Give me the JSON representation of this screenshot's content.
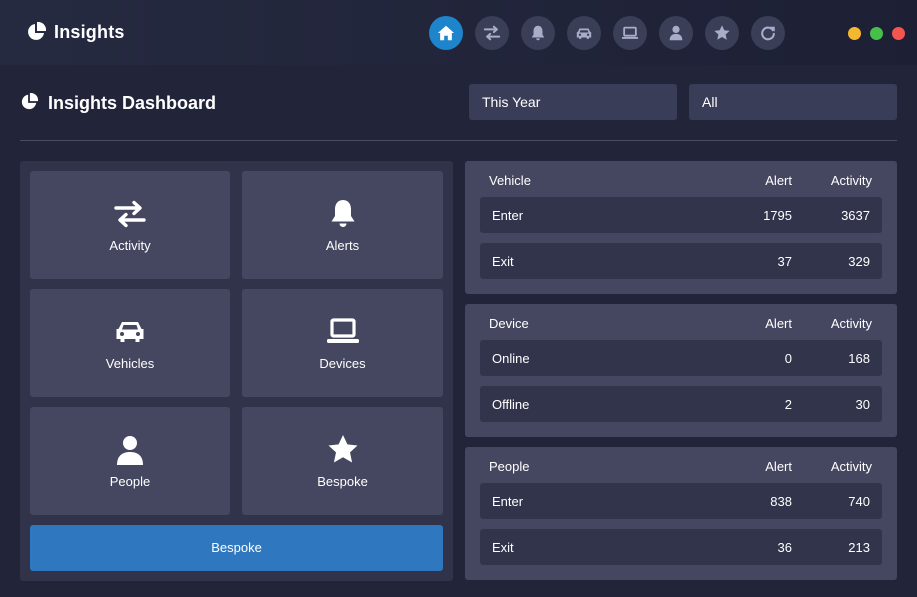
{
  "app": {
    "title": "Insights"
  },
  "nav": [
    {
      "name": "home",
      "icon": "home-icon",
      "active": true
    },
    {
      "name": "activity",
      "icon": "swap-arrows-icon",
      "active": false
    },
    {
      "name": "alerts",
      "icon": "bell-icon",
      "active": false
    },
    {
      "name": "vehicles",
      "icon": "car-icon",
      "active": false
    },
    {
      "name": "devices",
      "icon": "laptop-icon",
      "active": false
    },
    {
      "name": "people",
      "icon": "user-icon",
      "active": false
    },
    {
      "name": "bespoke",
      "icon": "star-icon",
      "active": false
    },
    {
      "name": "refresh",
      "icon": "refresh-icon",
      "active": false
    }
  ],
  "window_controls": {
    "colors": [
      "#f4b82e",
      "#47c04a",
      "#f4564f"
    ]
  },
  "dashboard": {
    "title": "Insights Dashboard",
    "period_select": "This Year",
    "filter_select": "All"
  },
  "tiles": [
    {
      "label": "Activity",
      "icon": "swap-arrows-icon"
    },
    {
      "label": "Alerts",
      "icon": "bell-icon"
    },
    {
      "label": "Vehicles",
      "icon": "car-icon"
    },
    {
      "label": "Devices",
      "icon": "laptop-icon"
    },
    {
      "label": "People",
      "icon": "user-icon"
    },
    {
      "label": "Bespoke",
      "icon": "star-icon"
    }
  ],
  "bespoke_button": "Bespoke",
  "cards": [
    {
      "title": "Vehicle",
      "alert_header": "Alert",
      "activity_header": "Activity",
      "rows": [
        {
          "name": "Enter",
          "alert": "1795",
          "activity": "3637"
        },
        {
          "name": "Exit",
          "alert": "37",
          "activity": "329"
        }
      ]
    },
    {
      "title": "Device",
      "alert_header": "Alert",
      "activity_header": "Activity",
      "rows": [
        {
          "name": "Online",
          "alert": "0",
          "activity": "168"
        },
        {
          "name": "Offline",
          "alert": "2",
          "activity": "30"
        }
      ]
    },
    {
      "title": "People",
      "alert_header": "Alert",
      "activity_header": "Activity",
      "rows": [
        {
          "name": "Enter",
          "alert": "838",
          "activity": "740"
        },
        {
          "name": "Exit",
          "alert": "36",
          "activity": "213"
        }
      ]
    }
  ],
  "colors": {
    "accent": "#1e84cc",
    "button": "#2f77be",
    "background": "#22253a"
  }
}
